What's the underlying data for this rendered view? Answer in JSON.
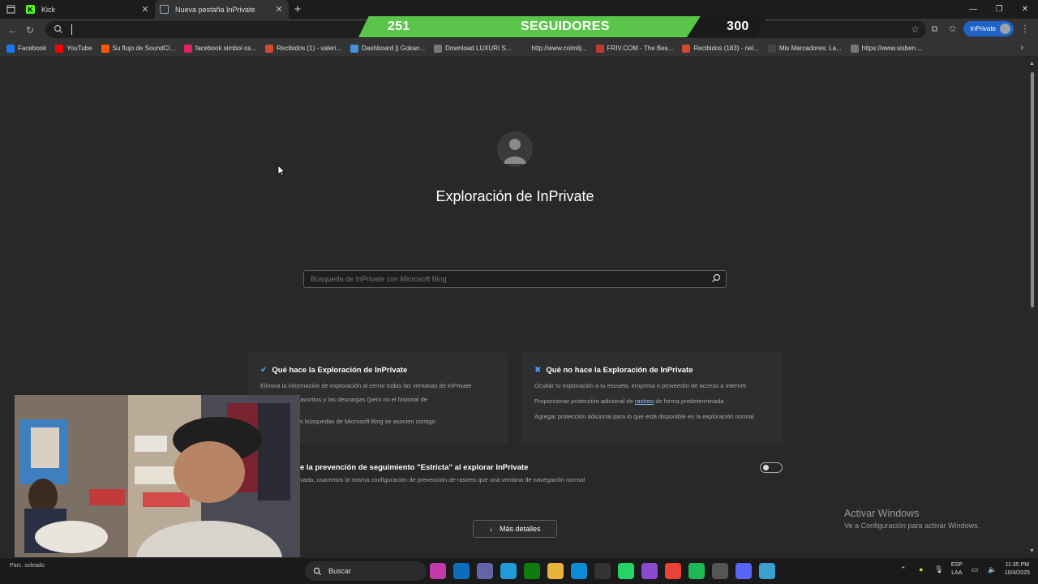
{
  "tabs": [
    {
      "title": "Kick",
      "icon": "kick-icon",
      "color": "#53fc18"
    },
    {
      "title": "Nueva pestaña InPrivate",
      "icon": "inprivate-tab-icon",
      "color": "#3b7bd8"
    }
  ],
  "address_bar": {
    "value": "",
    "placeholder": ""
  },
  "inprivate_label": "InPrivate",
  "follower_goal": {
    "current": "251",
    "label": "SEGUIDORES",
    "goal": "300",
    "progress": 0.837,
    "fill_color": "#5bc44a"
  },
  "bookmarks": [
    {
      "label": "Facebook",
      "icon": "facebook-icon",
      "color": "#1877f2"
    },
    {
      "label": "YouTube",
      "icon": "youtube-icon",
      "color": "#ff0000"
    },
    {
      "label": "Su flujo de SoundCl...",
      "icon": "soundcloud-icon",
      "color": "#ff5500"
    },
    {
      "label": "facebook simbol os...",
      "icon": "bolt-icon",
      "color": "#e0245e"
    },
    {
      "label": "Recibidos (1) - valeri...",
      "icon": "gmail-icon",
      "color": "#d44638"
    },
    {
      "label": "Dashboard || Gokan...",
      "icon": "globe-icon",
      "color": "#4a90d9"
    },
    {
      "label": "Download LUXURI S...",
      "icon": "page-icon",
      "color": "#777777"
    },
    {
      "label": "http://www.colmilj...",
      "icon": "blank-icon",
      "color": "#333333"
    },
    {
      "label": "FRIV.COM - The Bes...",
      "icon": "friv-icon",
      "color": "#c0392b"
    },
    {
      "label": "Recibidos (183) - nel...",
      "icon": "gmail-icon",
      "color": "#d44638"
    },
    {
      "label": "Mis Marcadores: La...",
      "icon": "marcador-icon",
      "color": "#444444"
    },
    {
      "label": "https://www.sisben....",
      "icon": "page-icon",
      "color": "#777777"
    }
  ],
  "main": {
    "title": "Exploración de InPrivate",
    "search_placeholder": "Búsqueda de InPrivate con Microsoft Bing",
    "does_card": {
      "title": "Qué hace la Exploración de InPrivate",
      "lines": [
        "Elimina la información de exploración al cerrar todas las ventanas de InPrivate",
        "lecciones, los favoritos y las descargas (pero no el historial de",
        "s búsquedas de Microsoft Bing se asocien contigo"
      ]
    },
    "doesnt_card": {
      "title": "Qué no hace la Exploración de InPrivate",
      "line1": "Ocultar tu exploración a tu escuela, empresa o proveedor de acceso a Internet",
      "line2_before": "Proporcionar protección adicional de ",
      "line2_link": "rastreo",
      "line2_after": " de forma predeterminada",
      "line3": "Agregar protección adicional para lo que está disponible en la exploración normal"
    },
    "strict": {
      "title": "e la prevención de seguimiento \"Estricta\" al explorar InPrivate",
      "desc": "vada, usaremos la misma configuración de prevención de rastreo que una ventana de navegación normal",
      "enabled": false
    },
    "more_details": "Más detalles"
  },
  "activate_windows": {
    "line1": "Activar Windows",
    "line2": "Ve a Configuración para activar Windows."
  },
  "taskbar": {
    "weather_text": "Parc. soleado",
    "search_label": "Buscar",
    "apps": [
      {
        "icon": "multicolor-app-icon",
        "color": "#c23aa8"
      },
      {
        "icon": "outlook-icon",
        "color": "#0f6cbd"
      },
      {
        "icon": "teams-icon",
        "color": "#6264a7"
      },
      {
        "icon": "copilot-icon",
        "color": "#1f9cd8"
      },
      {
        "icon": "xbox-icon",
        "color": "#107c10"
      },
      {
        "icon": "folder-icon",
        "color": "#e8b33a"
      },
      {
        "icon": "edge-icon",
        "color": "#0c8bd6"
      },
      {
        "icon": "store-icon",
        "color": "#333333"
      },
      {
        "icon": "whatsapp-icon",
        "color": "#25d366"
      },
      {
        "icon": "multicolor-app-icon",
        "color": "#8a4bd0"
      },
      {
        "icon": "chrome-icon",
        "color": "#ea4335"
      },
      {
        "icon": "spotify-icon",
        "color": "#1db954"
      },
      {
        "icon": "settings-icon",
        "color": "#555555"
      },
      {
        "icon": "discord-icon",
        "color": "#5865f2"
      },
      {
        "icon": "globe-icon",
        "color": "#3aa0d0"
      }
    ],
    "lang_top": "ESP",
    "lang_bottom": "LAA",
    "time": "11:35 PM",
    "date": "10/4/2025"
  }
}
